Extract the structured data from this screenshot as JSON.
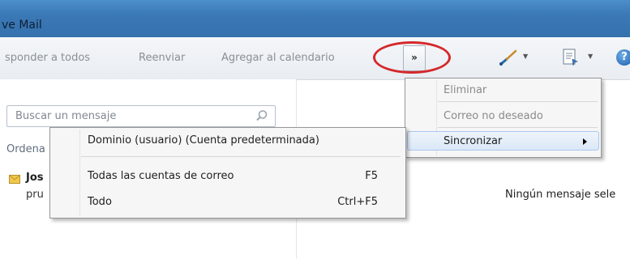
{
  "window": {
    "title": "ve Mail"
  },
  "toolbar": {
    "buttons": [
      "sponder a todos",
      "Reenviar",
      "Agregar al calendario"
    ],
    "overflow_label": "»",
    "help_label": "?",
    "highlight_color": "#d4282b"
  },
  "search": {
    "placeholder": "Buscar un mensaje"
  },
  "message_list": {
    "sort_label": "Ordena",
    "items": [
      {
        "sender": "Jos",
        "preview": "pru"
      }
    ]
  },
  "reading_pane": {
    "empty_text": "Ningún mensaje sele"
  },
  "overflow_menu": {
    "items": [
      {
        "label": "Eliminar",
        "enabled": false
      },
      {
        "label": "Correo no deseado",
        "enabled": false
      },
      {
        "label": "Sincronizar",
        "enabled": true,
        "has_submenu": true
      }
    ]
  },
  "sync_submenu": {
    "items": [
      {
        "label": "Dominio (usuario) (Cuenta predeterminada)",
        "shortcut": ""
      },
      {
        "label": "Todas las cuentas de correo",
        "shortcut": "F5"
      },
      {
        "label": "Todo",
        "shortcut": "Ctrl+F5"
      }
    ]
  }
}
